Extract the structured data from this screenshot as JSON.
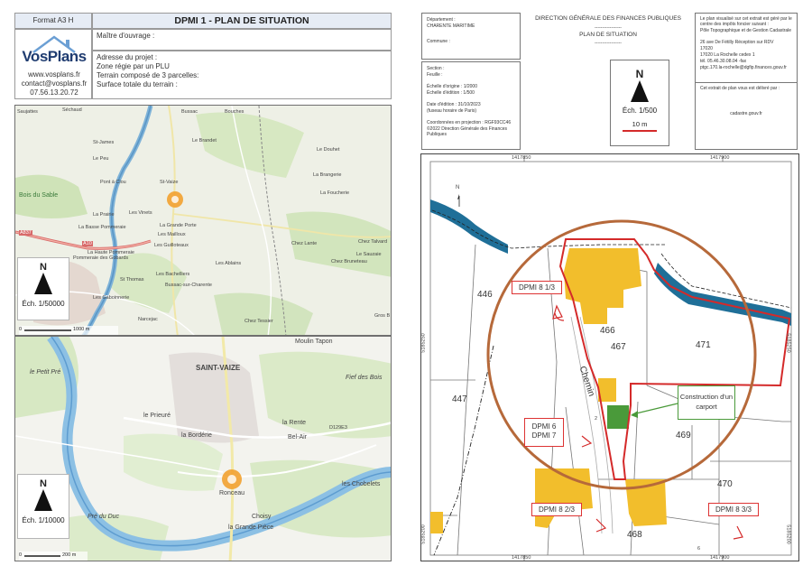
{
  "left_header": {
    "format_label": "Format A3 H",
    "title": "DPMI 1 - PLAN DE SITUATION",
    "owner_label": "Maître d'ouvrage :",
    "project_address_label": "Adresse du projet :",
    "zone": "Zone régie par un PLU",
    "parcels": "Terrain composé de 3 parcelles:",
    "surface": "Surface totale du terrain :",
    "logo_text": "VosPlans",
    "website": "www.vosplans.fr",
    "email": "contact@vosplans.fr",
    "phone": "07.56.13.20.72"
  },
  "map_top": {
    "scale_label": "Éch. 1/50000",
    "scale_bar_text": "1000 m",
    "scale_zero": "0",
    "places": [
      "Saujattes",
      "Séchaud",
      "Bussac",
      "Bouches",
      "Le Brandet",
      "Le Douhet",
      "St-James",
      "Le Peu",
      "Pont à Clou",
      "St-Vaize",
      "La Brangerie",
      "Bois du Sable",
      "La Prairie",
      "Les Vinets",
      "La Foucherie",
      "La Basse Pommeraie",
      "La Grande Porte",
      "Les Mailloux",
      "Chez Lante",
      "Chez Talvard",
      "La Haute Pommeraie",
      "Les Guilloteaux",
      "Chez Bruneteau",
      "Le Sauzaie",
      "Pommeraie des Gobards",
      "St Thomas",
      "Les Bachelliers",
      "Les Ablains",
      "Les Gaboinnerie",
      "Bussac-sur-Charente",
      "Narcejac",
      "Chez Tessier",
      "Gros B"
    ],
    "road_labels": [
      "A10",
      "A837"
    ],
    "north": "N"
  },
  "map_bottom": {
    "scale_label": "Éch. 1/10000",
    "scale_bar_text": "200 m",
    "scale_zero": "0",
    "places": [
      "Moulin Tapon",
      "SAINT-VAIZE",
      "Fief des Bois",
      "le Petit Pré",
      "le Prieuré",
      "la Rente",
      "la Bordérie",
      "Bel-Air",
      "Ronceau",
      "les Chobelets",
      "Pré du Duc",
      "Choisy",
      "la Grande Pièce"
    ],
    "road_labels": [
      "D129E3"
    ],
    "north": "N"
  },
  "cadastre_header": {
    "dept_label": "Département :",
    "dept_value": "CHARENTE MARITIME",
    "commune_label": "Commune :",
    "section_label": "Section :",
    "feuille_label": "Feuille :",
    "echelle_origine": "Échelle d'origine : 1/2000",
    "echelle_edition": "Échelle d'édition : 1/500",
    "date_edition": "Date d'édition : 31/10/2023",
    "fuseau": "(fuseau horaire de Paris)",
    "coords": "Coordonnées en projection : RGF93CC46",
    "copyright": "©2022 Direction Générale des Finances Publiques",
    "dgfip_title": "DIRECTION GÉNÉRALE DES FINANCES PUBLIQUES",
    "dashes1": "------------------",
    "plan_title": "PLAN DE SITUATION",
    "dashes2": "------------------",
    "north": "N",
    "scale_label": "Éch. 1/500",
    "scale_bar_text": "10 m",
    "right_text_1": "Le plan visualisé sur cet extrait est géré par le centre des impôts foncier suivant :",
    "right_text_2": "Pôle Topographique et de Gestion Cadastrale",
    "right_text_3": "26 ave De Fétilly Réception sur RDV",
    "right_text_4": "17020",
    "right_text_5": "17020 La Rochelle cedex 1",
    "right_text_6": "tél. 05.46.30.08.04 -fax",
    "right_text_7": "ptgc.170.la-rochelle@dgfip.finances.gouv.fr",
    "right_text_8": "Cet extrait de plan vous est délivré par :",
    "right_text_9": "cadastre.gouv.fr"
  },
  "cadastre_map": {
    "coord_top_1": "1417850",
    "coord_top_2": "1417900",
    "coord_bottom_1": "1417850",
    "coord_bottom_2": "1417900",
    "coord_left": "5185250",
    "coord_left_2": "5185200",
    "coord_right": "5185250",
    "coord_right_2": "5185200",
    "parcels": [
      "446",
      "466",
      "467",
      "471",
      "447",
      "469",
      "470",
      "468"
    ],
    "partial_label": "2",
    "street": "Chemin",
    "bottom_num": "6",
    "tags": [
      "DPMI 8 1/3",
      "DPMI 6",
      "DPMI 7",
      "DPMI 8 2/3",
      "DPMI 8 3/3"
    ],
    "construction": "Construction d'un carport",
    "north": "N"
  },
  "colors": {
    "red": "#d42a2a",
    "river": "#1f6f98",
    "building": "#f2be2c",
    "circle": "#b6693a",
    "green": "#4a9a3a"
  }
}
